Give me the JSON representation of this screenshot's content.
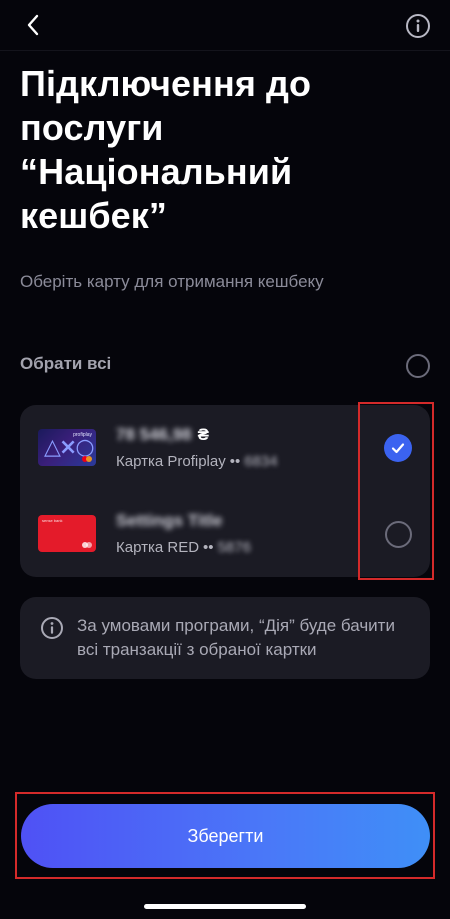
{
  "header": {
    "back_icon": "chevron-left-icon",
    "info_icon": "info-circle-icon"
  },
  "title": "Підключення до\nпослуги\n“Національний\nкешбек”",
  "subtitle": "Оберіть карту для отримання кешбеку",
  "select_all": {
    "label": "Обрати всі",
    "checked": false
  },
  "cards": [
    {
      "balance": "78 546,98",
      "currency": "₴",
      "name": "Картка Profiplay",
      "mask": "••",
      "last_digits": "6834",
      "checked": true,
      "thumb_text": "profiplay"
    },
    {
      "balance": "Settings Title",
      "currency": "",
      "name": "Картка RED",
      "mask": "••",
      "last_digits": "5876",
      "checked": false,
      "thumb_text": "sense bank"
    }
  ],
  "notice": {
    "icon": "info-circle-icon",
    "text": "За умовами програми, “Дія” буде бачити всі транзакції з обраної картки"
  },
  "save_button": {
    "label": "Зберегти"
  },
  "colors": {
    "background": "#05050b",
    "panel": "#1b1b24",
    "accent": "#3b63f0",
    "highlight": "#d42a2a"
  }
}
